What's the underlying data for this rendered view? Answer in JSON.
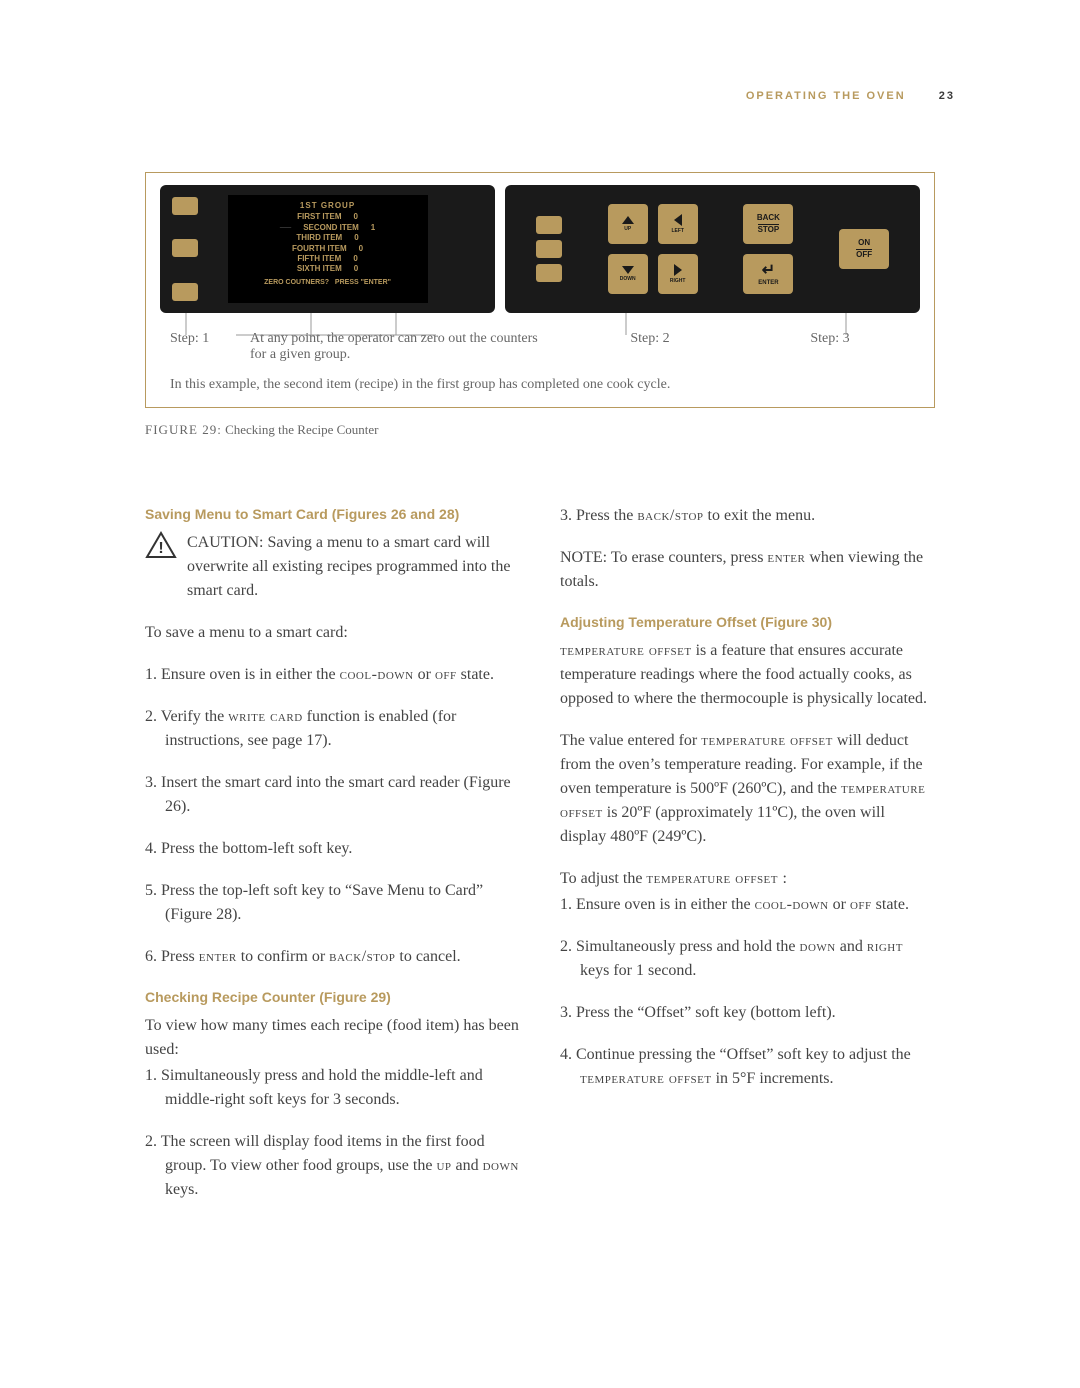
{
  "header": {
    "section_title": "OPERATING THE OVEN",
    "page_num": "23"
  },
  "figure": {
    "lcd": {
      "title": "1ST GROUP",
      "rows": [
        {
          "name": "FIRST ITEM",
          "val": "0"
        },
        {
          "name": "SECOND ITEM",
          "val": "1"
        },
        {
          "name": "THIRD ITEM",
          "val": "0"
        },
        {
          "name": "FOURTH ITEM",
          "val": "0"
        },
        {
          "name": "FIFTH ITEM",
          "val": "0"
        },
        {
          "name": "SIXTH ITEM",
          "val": "0"
        }
      ],
      "footer_left": "ZERO COUTNERS?",
      "footer_right": "PRESS \"ENTER\""
    },
    "controls": {
      "up": "UP",
      "down": "DOWN",
      "left": "LEFT",
      "right": "RIGHT",
      "back": "BACK",
      "stop": "STOP",
      "enter": "ENTER",
      "on": "ON",
      "off": "OFF"
    },
    "step1": "Step: 1",
    "step_note": "At any point, the operator can zero out the counters for a given group.",
    "step2": "Step: 2",
    "step3": "Step: 3",
    "example": "In this example, the second item (recipe) in the first group has completed one cook cycle.",
    "caption_label": "FIGURE 29:",
    "caption_text": " Checking the Recipe Counter"
  },
  "left_col": {
    "h1": "Saving Menu to Smart Card (Figures 26 and 28)",
    "caution": "CAUTION: Saving a menu to a smart card will overwrite all existing recipes programmed into the smart card.",
    "intro": "To save a menu to a smart card:",
    "l1a": "1. Ensure oven is in either the ",
    "l1b": "cool-down",
    "l1c": " or ",
    "l1d": "off",
    "l1e": " state.",
    "l2a": "2. Verify the ",
    "l2b": "write card",
    "l2c": " function is enabled (for instructions, see page 17).",
    "l3": "3. Insert the smart card into the smart card reader (Figure 26).",
    "l4": "4. Press the bottom-left soft key.",
    "l5": "5. Press the top-left soft key to “Save Menu to Card” (Figure 28).",
    "l6a": "6. Press ",
    "l6b": "enter",
    "l6c": " to confirm or ",
    "l6d": "back/stop",
    "l6e": " to cancel.",
    "h2": "Checking Recipe Counter (Figure 29)",
    "p2": "To view how many times each recipe (food item) has been used:",
    "c1": "1. Simultaneously press and hold the middle-left and middle-right soft keys for 3 seconds.",
    "c2a": "2. The screen will display food items in the first food group. To view other food groups, use the ",
    "c2b": "up",
    "c2c": " and ",
    "c2d": "down",
    "c2e": " keys."
  },
  "right_col": {
    "r3a": "3. Press the ",
    "r3b": "back/stop",
    "r3c": " to exit the menu.",
    "note_a": "NOTE: To erase counters, press ",
    "note_b": "enter",
    "note_c": " when viewing the totals.",
    "h1": "Adjusting Temperature Offset (Figure 30)",
    "p1a": "temperature offset",
    "p1b": " is a feature that ensures accurate temperature readings where the food actually cooks, as opposed to where the thermocouple is physically located.",
    "p2a": "The value entered for ",
    "p2b": "temperature offset",
    "p2c": " will deduct from the oven’s temperature reading. For example, if the oven temperature is 500ºF (260ºC), and the ",
    "p2d": "temperature offset",
    "p2e": " is 20ºF (approximately 11ºC), the oven will display 480ºF (249ºC).",
    "intro_a": "To adjust the ",
    "intro_b": "temperature offset ",
    "intro_c": ":",
    "t1a": "1. Ensure oven is in either the ",
    "t1b": "cool-down",
    "t1c": " or ",
    "t1d": "off",
    "t1e": " state.",
    "t2a": "2. Simultaneously press and hold the ",
    "t2b": "down",
    "t2c": " and ",
    "t2d": "right",
    "t2e": " keys for 1 second.",
    "t3": "3. Press the “Offset” soft key (bottom left).",
    "t4a": "4. Continue pressing the “Offset” soft key to adjust the ",
    "t4b": "temperature offset",
    "t4c": " in 5°F increments."
  }
}
